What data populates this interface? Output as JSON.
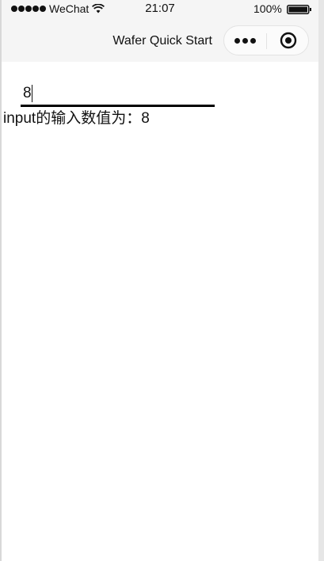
{
  "status_bar": {
    "carrier": "WeChat",
    "time": "21:07",
    "battery": "100%"
  },
  "nav": {
    "title": "Wafer Quick Start",
    "icons": {
      "more": "more-dots-icon",
      "close": "record-circle-icon"
    }
  },
  "form": {
    "input_value": "8",
    "output_label": "input的输入数值为：",
    "output_value": "8"
  },
  "colors": {
    "nav_background": "#f5f5f5",
    "page_background": "#ffffff",
    "text": "#111111",
    "underline": "#000000"
  }
}
